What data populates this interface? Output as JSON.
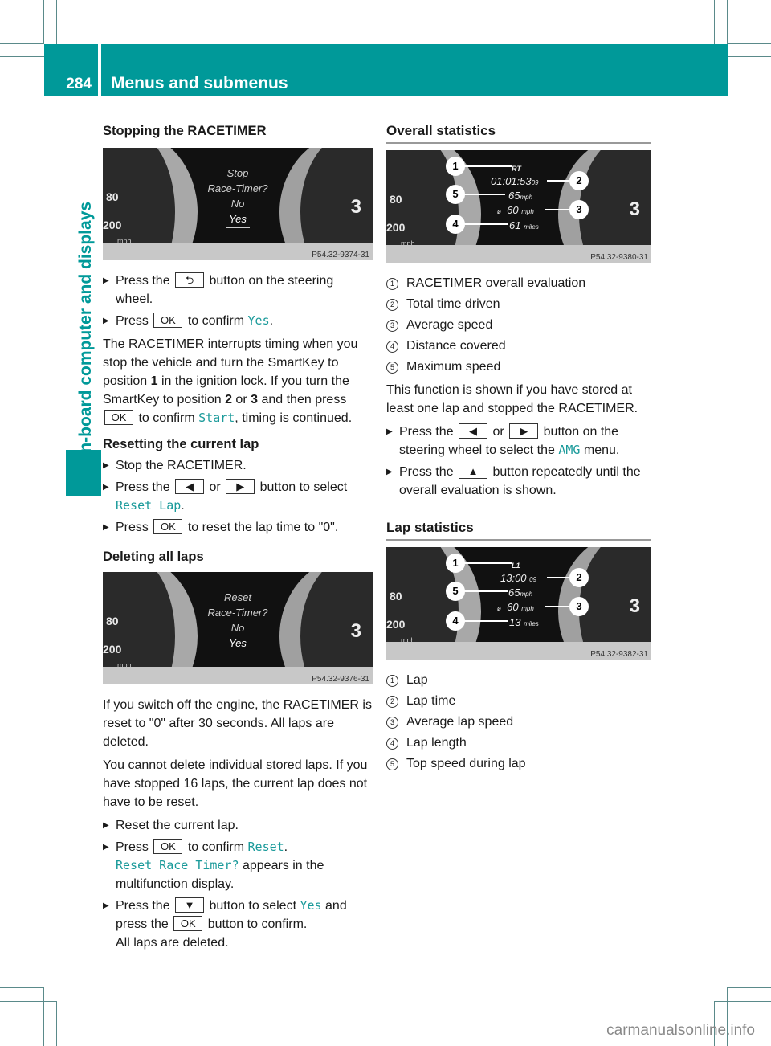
{
  "header": {
    "page_number": "284",
    "title": "Menus and submenus"
  },
  "side_tab": {
    "label": "On-board computer and displays"
  },
  "colors": {
    "accent": "#009999",
    "link_mono": "#1a9a9a"
  },
  "left": {
    "s1": {
      "heading": "Stopping the RACETIMER",
      "display": {
        "lines": [
          "Stop",
          "Race-Timer?",
          "No",
          "Yes"
        ],
        "code": "P54.32-9374-31"
      },
      "steps": [
        {
          "pre": "Press the",
          "key": "back-icon",
          "key_glyph": "⮌",
          "post": "button on the steering wheel."
        },
        {
          "pre": "Press",
          "key_label": "OK",
          "mid": "to confirm",
          "mono": "Yes",
          "post": "."
        }
      ],
      "para": {
        "t1": "The RACETIMER interrupts timing when you stop the vehicle and turn the SmartKey to position ",
        "b1": "1",
        "t2": " in the ignition lock. If you turn the SmartKey to position ",
        "b2": "2",
        "t3": " or ",
        "b3": "3",
        "t4": " and then press ",
        "key": "OK",
        "t5": " to confirm ",
        "mono": "Start",
        "t6": ", timing is continued."
      }
    },
    "s2": {
      "heading": "Resetting the current lap",
      "step1": "Stop the RACETIMER.",
      "step2": {
        "pre": "Press the",
        "left": "◀",
        "or": "or",
        "right": "▶",
        "post": "button to select",
        "mono": "Reset Lap",
        "end": "."
      },
      "step3": {
        "pre": "Press",
        "key": "OK",
        "post": "to reset the lap time to \"0\"."
      }
    },
    "s3": {
      "heading": "Deleting all laps",
      "display": {
        "lines": [
          "Reset",
          "Race-Timer?",
          "No",
          "Yes"
        ],
        "code": "P54.32-9376-31"
      },
      "p1": "If you switch off the engine, the RACETIMER is reset to \"0\" after 30 seconds. All laps are deleted.",
      "p2": "You cannot delete individual stored laps. If you have stopped 16 laps, the current lap does not have to be reset.",
      "step1": "Reset the current lap.",
      "step2": {
        "pre": "Press",
        "key": "OK",
        "mid": "to confirm",
        "mono": "Reset",
        "end": ".",
        "mono2": "Reset Race Timer?",
        "post": "appears in the multifunction display."
      },
      "step3": {
        "pre": "Press the",
        "down": "▼",
        "mid": "button to select",
        "mono": "Yes",
        "and": "and press the",
        "key": "OK",
        "post": "button to confirm.",
        "result": "All laps are deleted."
      }
    }
  },
  "right": {
    "s1": {
      "heading": "Overall statistics",
      "display": {
        "label": "RT",
        "time": "01:01:53",
        "time_frac": "09",
        "max_speed": "65",
        "avg_symbol": "ø",
        "avg_speed": "60",
        "unit": "mph",
        "distance": "61",
        "dist_unit": "miles",
        "code": "P54.32-9380-31"
      },
      "legend": [
        "RACETIMER overall evaluation",
        "Total time driven",
        "Average speed",
        "Distance covered",
        "Maximum speed"
      ],
      "para": "This function is shown if you have stored at least one lap and stopped the RACETIMER.",
      "step1": {
        "pre": "Press the",
        "left": "◀",
        "or": "or",
        "right": "▶",
        "post": "button on the steering wheel to select the",
        "mono": "AMG",
        "end": "menu."
      },
      "step2": {
        "pre": "Press the",
        "up": "▲",
        "post": "button repeatedly until the overall evaluation is shown."
      }
    },
    "s2": {
      "heading": "Lap statistics",
      "display": {
        "label": "L1",
        "time": "13:00",
        "time_frac": "09",
        "max_speed": "65",
        "avg_symbol": "ø",
        "avg_speed": "60",
        "unit": "mph",
        "distance": "13",
        "dist_unit": "miles",
        "code": "P54.32-9382-31"
      },
      "legend": [
        "Lap",
        "Lap time",
        "Average lap speed",
        "Lap length",
        "Top speed during lap"
      ]
    }
  },
  "gauge": {
    "n80": "80",
    "n200": "200",
    "unit": "mph",
    "gear": "3"
  },
  "callouts": [
    "1",
    "2",
    "3",
    "4",
    "5"
  ],
  "watermark": "carmanualsonline.info"
}
